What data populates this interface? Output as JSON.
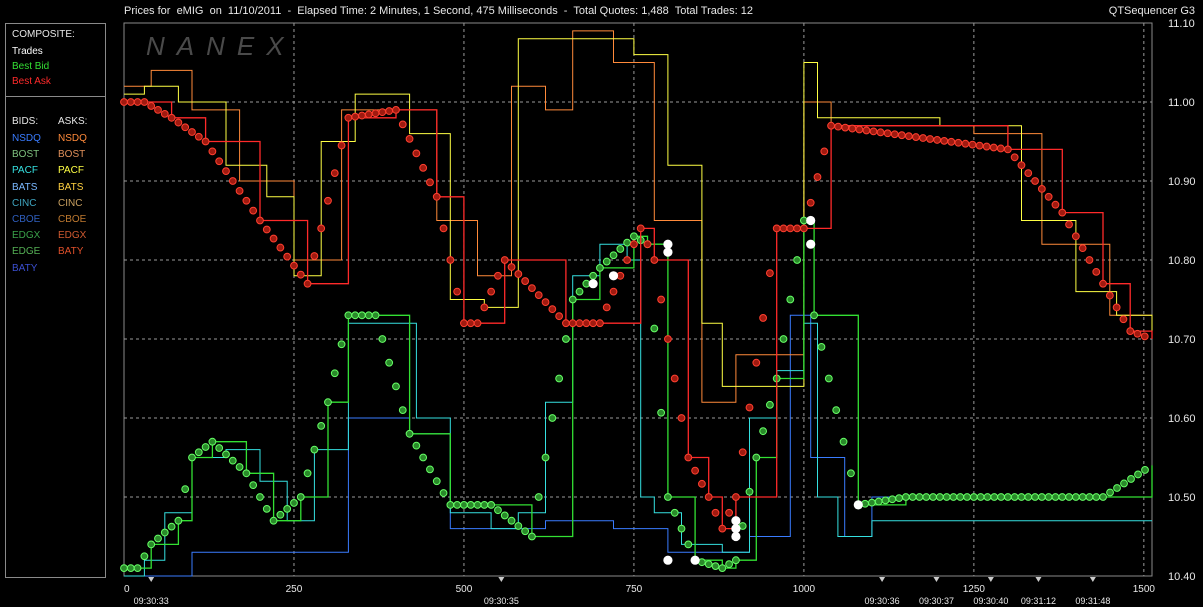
{
  "header": {
    "title": "Prices for  eMIG  on  11/10/2011  -  Elapsed Time: 2 Minutes, 1 Second, 475 Milliseconds  -  Total Quotes: 1,488  Total Trades: 12",
    "app_name": "QTSequencer G3",
    "watermark": "NANEX"
  },
  "legend": {
    "composite_header": "COMPOSITE:",
    "composite": [
      {
        "label": "Trades",
        "color": "#ffffff"
      },
      {
        "label": "Best Bid",
        "color": "#33e033"
      },
      {
        "label": "Best Ask",
        "color": "#ff2a2a"
      }
    ],
    "bids_header": "BIDS:",
    "asks_header": "ASKS:",
    "bids": [
      {
        "label": "NSDQ",
        "color": "#3a7cff"
      },
      {
        "label": "BOST",
        "color": "#7fc17f"
      },
      {
        "label": "PACF",
        "color": "#35e0e0"
      },
      {
        "label": "BATS",
        "color": "#7ab8ff"
      },
      {
        "label": "CINC",
        "color": "#3fa5c0"
      },
      {
        "label": "CBOE",
        "color": "#2f5fbf"
      },
      {
        "label": "EDGX",
        "color": "#3aa24a"
      },
      {
        "label": "EDGE",
        "color": "#55b055"
      },
      {
        "label": "BATY",
        "color": "#3b4fd0"
      }
    ],
    "asks": [
      {
        "label": "NSDQ",
        "color": "#ff8a3a"
      },
      {
        "label": "BOST",
        "color": "#e0905a"
      },
      {
        "label": "PACF",
        "color": "#ffff44"
      },
      {
        "label": "BATS",
        "color": "#ffd040"
      },
      {
        "label": "CINC",
        "color": "#c8a060"
      },
      {
        "label": "CBOE",
        "color": "#c07a30"
      },
      {
        "label": "EDGX",
        "color": "#d05a30"
      },
      {
        "label": "BATY",
        "color": "#e0502a"
      }
    ]
  },
  "chart_data": {
    "type": "line",
    "x_ticks": [
      0,
      250,
      500,
      750,
      1000,
      1250,
      1500
    ],
    "xlim": [
      0,
      1512
    ],
    "time_labels": [
      {
        "seq": 40,
        "label": "09:30:33"
      },
      {
        "seq": 555,
        "label": "09:30:35"
      },
      {
        "seq": 1115,
        "label": "09:30:36"
      },
      {
        "seq": 1195,
        "label": "09:30:37"
      },
      {
        "seq": 1275,
        "label": "09:30:40"
      },
      {
        "seq": 1345,
        "label": "09:31:12"
      },
      {
        "seq": 1425,
        "label": "09:31:48"
      }
    ],
    "y_ticks": [
      "10.40",
      "10.50",
      "10.60",
      "10.70",
      "10.80",
      "10.90",
      "11.00",
      "11.10"
    ],
    "ylim": [
      10.4,
      11.1
    ],
    "grid": true,
    "series": [
      {
        "role": "best_ask",
        "color": "#ff2a2a",
        "x": [
          0,
          30,
          70,
          120,
          200,
          270,
          330,
          400,
          460,
          500,
          520,
          560,
          650,
          700,
          760,
          780,
          830,
          860,
          880,
          900,
          960,
          1000,
          1040,
          1300,
          1380,
          1440,
          1480,
          1512
        ],
        "y": [
          11.0,
          11.0,
          10.98,
          10.95,
          10.85,
          10.77,
          10.98,
          10.99,
          10.88,
          10.72,
          10.72,
          10.8,
          10.72,
          10.72,
          10.84,
          10.8,
          10.55,
          10.5,
          10.46,
          10.5,
          10.84,
          10.84,
          10.97,
          10.94,
          10.86,
          10.77,
          10.71,
          10.7
        ]
      },
      {
        "role": "best_bid",
        "color": "#33e033",
        "x": [
          0,
          20,
          40,
          80,
          100,
          130,
          180,
          220,
          260,
          300,
          330,
          370,
          420,
          480,
          540,
          600,
          660,
          700,
          750,
          770,
          800,
          840,
          880,
          900,
          930,
          960,
          1000,
          1015,
          1080,
          1150,
          1300,
          1440,
          1512
        ],
        "y": [
          10.41,
          10.41,
          10.44,
          10.47,
          10.55,
          10.57,
          10.53,
          10.47,
          10.5,
          10.62,
          10.73,
          10.73,
          10.58,
          10.49,
          10.49,
          10.45,
          10.75,
          10.79,
          10.83,
          10.82,
          10.5,
          10.42,
          10.41,
          10.42,
          10.55,
          10.65,
          10.85,
          10.73,
          10.49,
          10.5,
          10.5,
          10.5,
          10.54
        ]
      },
      {
        "role": "ask_pacf",
        "color": "#ffff44",
        "x": [
          0,
          30,
          80,
          150,
          210,
          250,
          290,
          340,
          420,
          480,
          530,
          580,
          620,
          670,
          750,
          800,
          850,
          880,
          1000,
          1020,
          1200,
          1320,
          1400,
          1460,
          1512
        ],
        "y": [
          11.01,
          11.02,
          11.0,
          10.92,
          10.88,
          10.78,
          10.95,
          11.01,
          10.96,
          10.75,
          10.74,
          11.08,
          11.08,
          11.08,
          11.06,
          10.92,
          10.72,
          10.64,
          11.05,
          10.98,
          10.97,
          10.85,
          10.76,
          10.73,
          10.71
        ]
      },
      {
        "role": "ask_nsdq",
        "color": "#ff8a3a",
        "x": [
          0,
          40,
          100,
          170,
          250,
          320,
          400,
          460,
          520,
          570,
          620,
          660,
          720,
          780,
          850,
          900,
          1000,
          1040,
          1250,
          1350,
          1450,
          1512
        ],
        "y": [
          11.02,
          11.04,
          10.99,
          10.9,
          10.8,
          10.99,
          10.99,
          10.85,
          10.78,
          11.02,
          10.99,
          11.09,
          11.05,
          10.85,
          10.62,
          10.68,
          11.0,
          10.97,
          10.96,
          10.82,
          10.73,
          10.71
        ]
      },
      {
        "role": "bid_pacf",
        "color": "#35e0e0",
        "x": [
          0,
          30,
          60,
          100,
          150,
          200,
          240,
          280,
          330,
          380,
          430,
          480,
          540,
          580,
          620,
          660,
          700,
          740,
          760,
          780,
          820,
          880,
          920,
          960,
          1000,
          1020,
          1050,
          1100,
          1512
        ],
        "y": [
          10.4,
          10.42,
          10.48,
          10.55,
          10.56,
          10.52,
          10.47,
          10.56,
          10.72,
          10.72,
          10.6,
          10.48,
          10.46,
          10.48,
          10.62,
          10.78,
          10.82,
          10.8,
          10.5,
          10.48,
          10.44,
          10.43,
          10.6,
          10.66,
          10.72,
          10.5,
          10.45,
          10.47,
          10.47
        ]
      },
      {
        "role": "bid_nsdq",
        "color": "#3a7cff",
        "x": [
          0,
          100,
          200,
          300,
          330,
          360,
          420,
          480,
          560,
          620,
          680,
          720,
          760,
          800,
          860,
          920,
          980,
          1010,
          1060,
          1100,
          1200,
          1512
        ],
        "y": [
          10.4,
          10.43,
          10.43,
          10.43,
          10.6,
          10.6,
          10.58,
          10.46,
          10.46,
          10.47,
          10.47,
          10.46,
          10.46,
          10.43,
          10.43,
          10.45,
          10.73,
          10.55,
          10.45,
          10.5,
          10.5,
          10.5
        ]
      }
    ],
    "trades": [
      {
        "x": 690,
        "y": 10.77
      },
      {
        "x": 720,
        "y": 10.78
      },
      {
        "x": 800,
        "y": 10.82
      },
      {
        "x": 800,
        "y": 10.81
      },
      {
        "x": 800,
        "y": 10.42
      },
      {
        "x": 840,
        "y": 10.42
      },
      {
        "x": 900,
        "y": 10.47
      },
      {
        "x": 900,
        "y": 10.46
      },
      {
        "x": 900,
        "y": 10.45
      },
      {
        "x": 1010,
        "y": 10.85
      },
      {
        "x": 1010,
        "y": 10.82
      },
      {
        "x": 1080,
        "y": 10.49
      }
    ]
  }
}
